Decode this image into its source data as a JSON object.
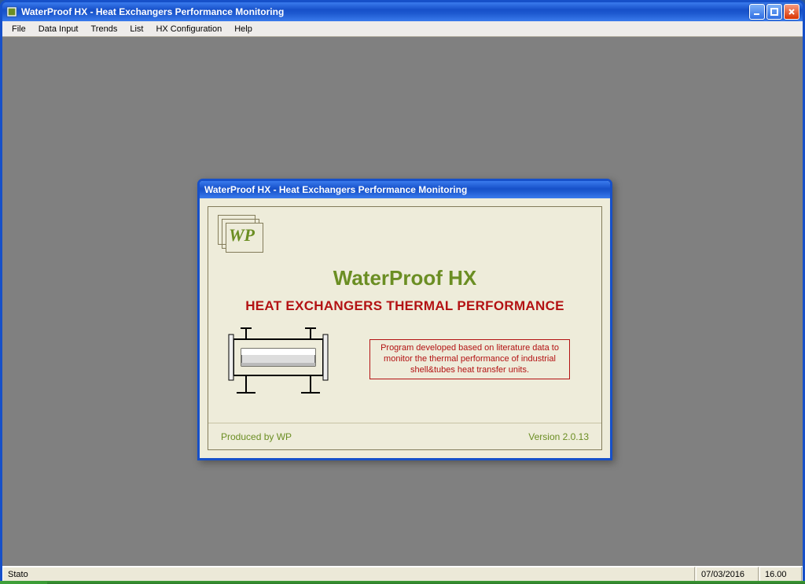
{
  "window": {
    "title": "WaterProof HX  - Heat Exchangers Performance Monitoring"
  },
  "menu": {
    "file": "File",
    "data_input": "Data Input",
    "trends": "Trends",
    "list": "List",
    "hx_config": "HX Configuration",
    "help": "Help"
  },
  "splash": {
    "title": "WaterProof HX - Heat Exchangers Performance Monitoring",
    "logo_text": "WP",
    "heading": "WaterProof HX",
    "subheading": "HEAT EXCHANGERS THERMAL PERFORMANCE",
    "description": "Program developed based on literature data to monitor the thermal performance  of industrial shell&tubes heat transfer units.",
    "produced_by": "Produced by WP",
    "version": "Version 2.0.13"
  },
  "status": {
    "main": "Stato",
    "date": "07/03/2016",
    "time": "16.00"
  }
}
